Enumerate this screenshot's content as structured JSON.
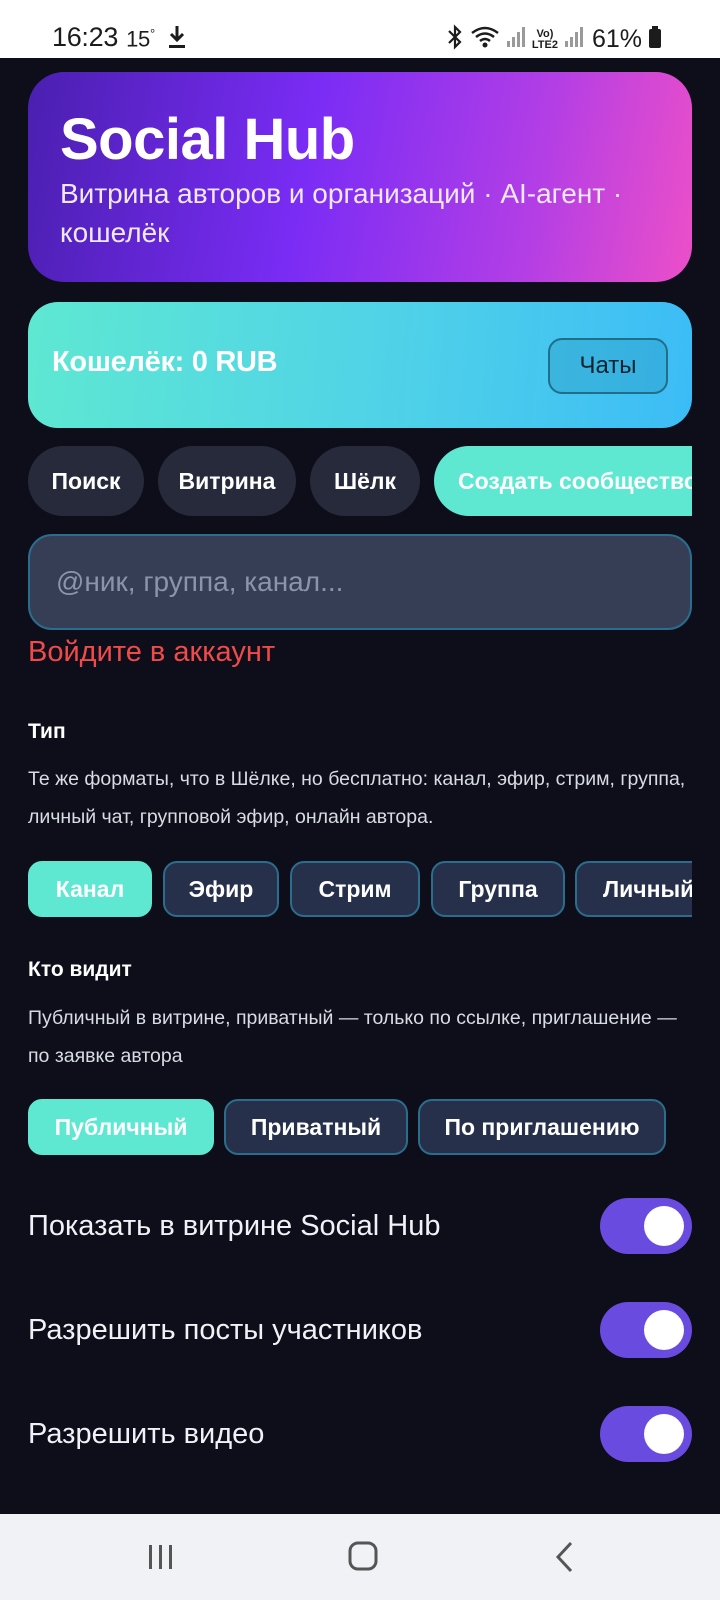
{
  "status_bar": {
    "time": "16:23",
    "temp": "15",
    "temp_unit": "°",
    "lte_top": "Vo)",
    "lte_bottom": "LTE2",
    "battery": "61%"
  },
  "hero": {
    "title": "Social Hub",
    "subtitle": "Витрина авторов и организаций · AI-агент · кошелёк"
  },
  "wallet": {
    "label": "Кошелёк: 0 RUB",
    "chats_button": "Чаты"
  },
  "nav": {
    "items": [
      "Поиск",
      "Витрина",
      "Шёлк",
      "Создать сообщество"
    ]
  },
  "search": {
    "placeholder": "@ник, группа, канал..."
  },
  "login_warning": "Войдите в аккаунт",
  "type_section": {
    "title": "Тип",
    "description": "Те же форматы, что в Шёлке, но бесплатно: канал, эфир, стрим, группа, личный чат, групповой эфир, онлайн автора.",
    "options": [
      "Канал",
      "Эфир",
      "Стрим",
      "Группа",
      "Личный"
    ],
    "selected": "Канал"
  },
  "visibility_section": {
    "title": "Кто видит",
    "description": "Публичный в витрине, приватный — только по ссылке, приглашение — по заявке автора",
    "options": [
      "Публичный",
      "Приватный",
      "По приглашению"
    ],
    "selected": "Публичный"
  },
  "toggles": [
    {
      "label": "Показать в витрине Social Hub",
      "on": true
    },
    {
      "label": "Разрешить посты участников",
      "on": true
    },
    {
      "label": "Разрешить видео",
      "on": true
    }
  ],
  "colors": {
    "accent_teal": "#5ee8d2",
    "accent_purple": "#6a4be0",
    "error_red": "#f04a4a",
    "background": "#0d0e1a"
  }
}
